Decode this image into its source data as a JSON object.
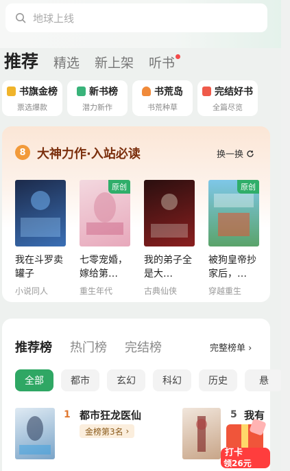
{
  "search": {
    "placeholder": "地球上线"
  },
  "tabs": [
    {
      "label": "推荐",
      "active": true
    },
    {
      "label": "精选",
      "active": false
    },
    {
      "label": "新上架",
      "active": false
    },
    {
      "label": "听书",
      "active": false,
      "dot": true
    }
  ],
  "categories": [
    {
      "title": "书旗金榜",
      "sub": "票选爆款",
      "icon": "trophy-icon",
      "color": "#f0b42b"
    },
    {
      "title": "新书榜",
      "sub": "潜力新作",
      "icon": "book-open-icon",
      "color": "#39b37a"
    },
    {
      "title": "书荒岛",
      "sub": "书荒种草",
      "icon": "island-icon",
      "color": "#f08a3a"
    },
    {
      "title": "完结好书",
      "sub": "全篇尽览",
      "icon": "bookmark-icon",
      "color": "#ef5a4a"
    }
  ],
  "featured": {
    "badge": "8",
    "title": "大神力作·入站必读",
    "swap_label": "换一换",
    "books": [
      {
        "title": "我在斗罗卖罐子",
        "title_display": "我在斗罗\n卖罐子",
        "genre": "小说同人",
        "tag": "",
        "colors": [
          "#1c2a4a",
          "#3a6fb5"
        ]
      },
      {
        "title": "七零宠婚，嫁给第…",
        "title_display": "七零宠婚，\n嫁给第…",
        "genre": "重生年代",
        "tag": "原创",
        "colors": [
          "#f3d8df",
          "#e7a8bb"
        ]
      },
      {
        "title": "我的弟子全是大…",
        "title_display": "我的弟子\n全是大…",
        "genre": "古典仙侠",
        "tag": "",
        "colors": [
          "#2a0f0f",
          "#8a1f1f"
        ]
      },
      {
        "title": "被狗皇帝抄家后，…",
        "title_display": "被狗皇帝\n抄家后，…",
        "genre": "穿越重生",
        "tag": "原创",
        "colors": [
          "#7ec7e8",
          "#5aa36a"
        ]
      }
    ]
  },
  "ranking": {
    "tabs": [
      {
        "label": "推荐榜",
        "active": true
      },
      {
        "label": "热门榜",
        "active": false
      },
      {
        "label": "完结榜",
        "active": false
      }
    ],
    "full_label": "完整榜单",
    "pills": [
      {
        "label": "全部",
        "active": true
      },
      {
        "label": "都市",
        "active": false
      },
      {
        "label": "玄幻",
        "active": false
      },
      {
        "label": "科幻",
        "active": false
      },
      {
        "label": "历史",
        "active": false
      },
      {
        "label": "悬",
        "active": false
      }
    ],
    "items": [
      {
        "rank": "1",
        "title": "都市狂龙医仙",
        "badge": "金榜第3名"
      },
      {
        "rank": "5",
        "title": "我有"
      }
    ]
  },
  "promo": {
    "line1": "打卡",
    "line2": "领26元"
  }
}
